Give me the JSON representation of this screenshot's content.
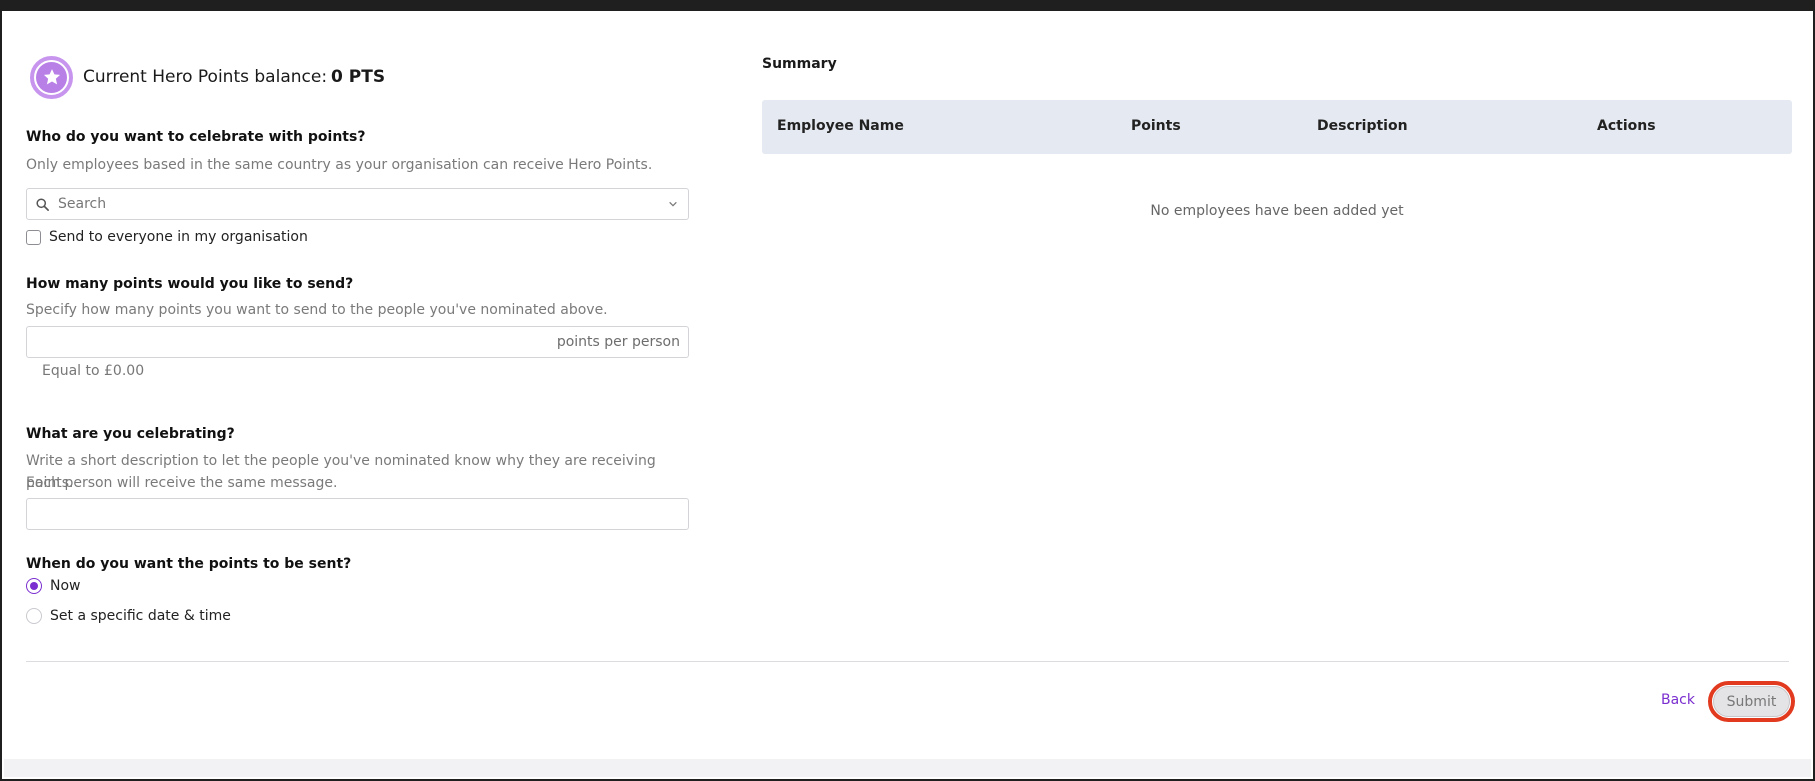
{
  "balance": {
    "label": "Current Hero Points balance:",
    "value": "0 PTS"
  },
  "recipients": {
    "question": "Who do you want to celebrate with points?",
    "hint": "Only employees based in the same country as your organisation can receive Hero Points.",
    "search_placeholder": "Search",
    "send_all_label": "Send to everyone in my organisation",
    "send_all_checked": false
  },
  "points": {
    "question": "How many points would you like to send?",
    "hint": "Specify how many points you want to send to the people you've nominated above.",
    "suffix": "points per person",
    "equivalent": "Equal to £0.00"
  },
  "celebration": {
    "question": "What are you celebrating?",
    "hint_line1": "Write a short description to let the people you've nominated know why they are receiving points.",
    "hint_line2": "Each person will receive the same message."
  },
  "timing": {
    "question": "When do you want the points to be sent?",
    "options": [
      {
        "label": "Now",
        "selected": true
      },
      {
        "label": "Set a specific date & time",
        "selected": false
      }
    ]
  },
  "summary": {
    "title": "Summary",
    "columns": [
      "Employee Name",
      "Points",
      "Description",
      "Actions"
    ],
    "empty_message": "No employees have been added yet"
  },
  "footer": {
    "back_label": "Back",
    "submit_label": "Submit"
  },
  "colors": {
    "accent": "#7b2fd0",
    "highlight": "#e23a1f",
    "badge": "#b880e6"
  }
}
